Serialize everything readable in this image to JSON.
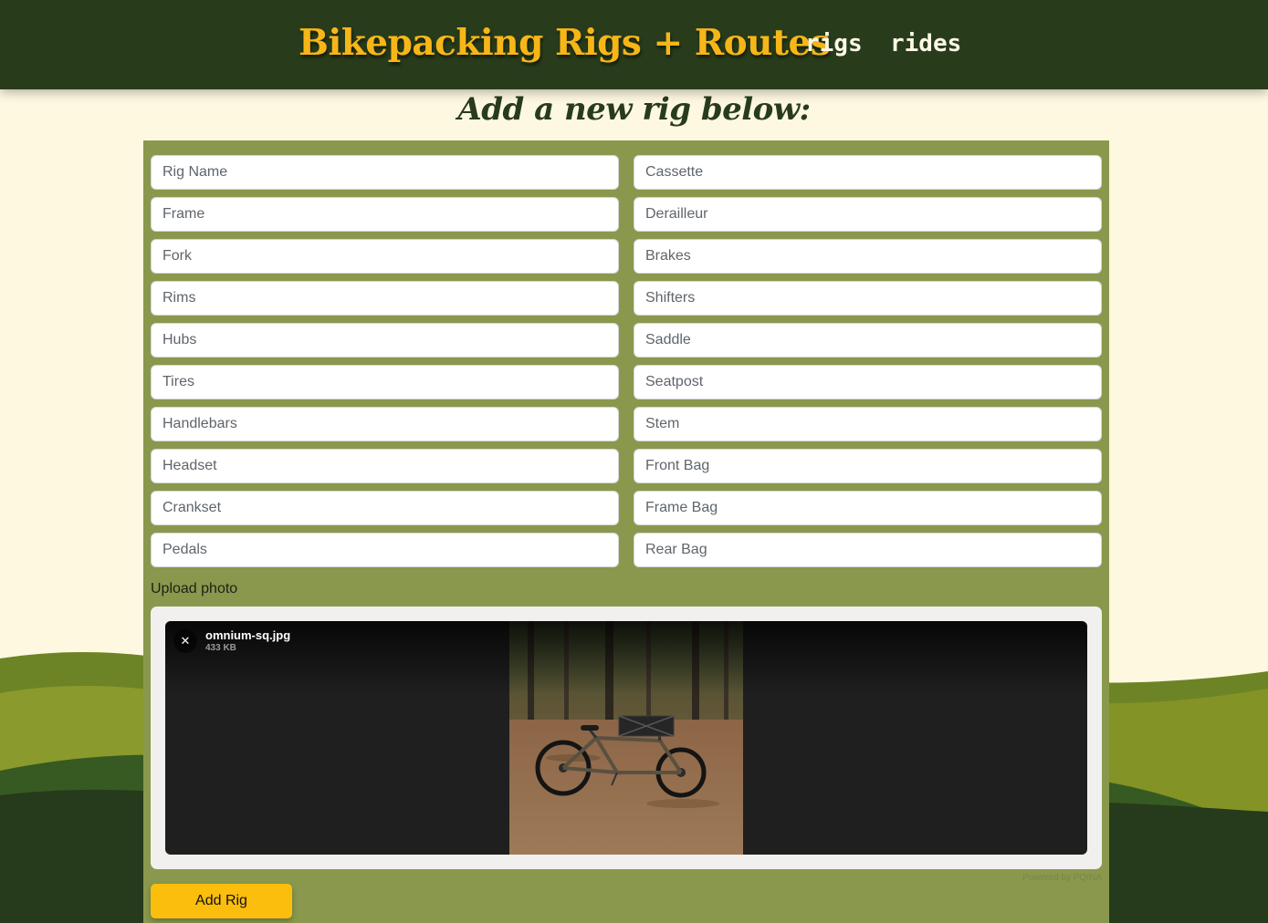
{
  "header": {
    "brand": "Bikepacking Rigs + Routes",
    "nav": [
      {
        "label": "rigs"
      },
      {
        "label": "rides"
      }
    ]
  },
  "page": {
    "title": "Add a new rig below:"
  },
  "form": {
    "left_fields": [
      {
        "placeholder": "Rig Name",
        "value": ""
      },
      {
        "placeholder": "Frame",
        "value": ""
      },
      {
        "placeholder": "Fork",
        "value": ""
      },
      {
        "placeholder": "Rims",
        "value": ""
      },
      {
        "placeholder": "Hubs",
        "value": ""
      },
      {
        "placeholder": "Tires",
        "value": ""
      },
      {
        "placeholder": "Handlebars",
        "value": ""
      },
      {
        "placeholder": "Headset",
        "value": ""
      },
      {
        "placeholder": "Crankset",
        "value": ""
      },
      {
        "placeholder": "Pedals",
        "value": ""
      }
    ],
    "right_fields": [
      {
        "placeholder": "Cassette",
        "value": ""
      },
      {
        "placeholder": "Derailleur",
        "value": ""
      },
      {
        "placeholder": "Brakes",
        "value": ""
      },
      {
        "placeholder": "Shifters",
        "value": ""
      },
      {
        "placeholder": "Saddle",
        "value": ""
      },
      {
        "placeholder": "Seatpost",
        "value": ""
      },
      {
        "placeholder": "Stem",
        "value": ""
      },
      {
        "placeholder": "Front Bag",
        "value": ""
      },
      {
        "placeholder": "Frame Bag",
        "value": ""
      },
      {
        "placeholder": "Rear Bag",
        "value": ""
      }
    ],
    "upload_label": "Upload photo",
    "upload": {
      "file_name": "omnium-sq.jpg",
      "file_size": "433 KB",
      "remove_icon": "close-icon",
      "credit": "Powered by PQINA"
    },
    "submit_label": "Add Rig"
  },
  "colors": {
    "header_bg": "#283c1b",
    "brand": "#f7b618",
    "page_bg": "#fef8e1",
    "form_bg": "#89984d",
    "button": "#fcbe0c"
  }
}
